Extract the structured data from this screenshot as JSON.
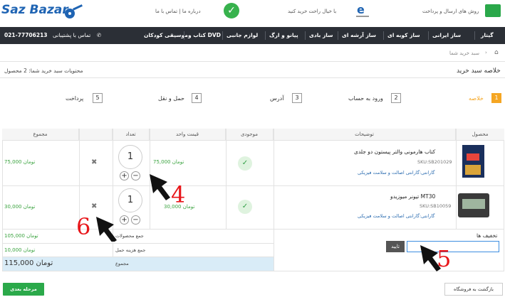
{
  "header": {
    "logo": "Saz Bazar",
    "shipping_text": "روش های ارسال و پرداخت",
    "trust_text": "با خیال راحت خرید کنید",
    "about_contact": "درباره ما | تماس با ما"
  },
  "nav": {
    "items": [
      "گیتار",
      "ساز ایرانی",
      "ساز کوبه ای",
      "ساز آرشه ای",
      "ساز بادی",
      "پیانو و ارگ",
      "لوازم جانبی",
      "کتاب و DVD",
      "موسیقی کودکان"
    ],
    "support_label": "تماس با پشتیبانی",
    "support_phone": "021-77706213"
  },
  "breadcrumb": {
    "current": "سبد خرید شما"
  },
  "page": {
    "title": "خلاصه سبد خرید",
    "cart_count": "محتویات سبد خرید شما: 2 محصول"
  },
  "steps": [
    {
      "num": "1",
      "label": "خلاصه",
      "active": true
    },
    {
      "num": "2",
      "label": "ورود به حساب"
    },
    {
      "num": "3",
      "label": "آدرس"
    },
    {
      "num": "4",
      "label": "حمل و نقل"
    },
    {
      "num": "5",
      "label": "پرداخت"
    }
  ],
  "table": {
    "headers": {
      "product": "محصول",
      "description": "توضیحات",
      "availability": "موجودی",
      "unit_price": "قیمت واحد",
      "quantity": "تعداد",
      "total": "مجموع"
    },
    "rows": [
      {
        "name": "کتاب هارمونی والتر پیستون دو جلدی",
        "sku": "SKU:SB201029",
        "warranty": "گارانتی:گارانتی اصالت و سلامت فیزیکی",
        "unit_price": "75,000 تومان",
        "qty": "1",
        "total": "75,000 تومان",
        "remove": "✖"
      },
      {
        "name": "تیونر میوزیدو MT30",
        "sku": "SKU:SB10059",
        "warranty": "گارانتی:گارانتی اصالت و سلامت فیزیکی",
        "unit_price": "30,000 تومان",
        "qty": "1",
        "total": "30,000 تومان",
        "remove": "✖"
      }
    ],
    "summary": {
      "products_label": "جمع محصولات",
      "products_value": "105,000 تومان",
      "shipping_label": "جمع هزینه حمل",
      "shipping_value": "10,000 تومان",
      "total_label": "مجموع",
      "total_value": "115,000 تومان"
    }
  },
  "discount": {
    "label": "تخفیف ها",
    "button": "تایید",
    "value": ""
  },
  "buttons": {
    "next": "مرحله بعدی",
    "back": "بازگشت به فروشگاه"
  },
  "annotations": [
    "4",
    "5",
    "6"
  ],
  "colors": {
    "nav_bg": "#2b2f36",
    "green": "#3aa33f",
    "active_step": "#f5a623",
    "annotation": "#e8161a"
  }
}
